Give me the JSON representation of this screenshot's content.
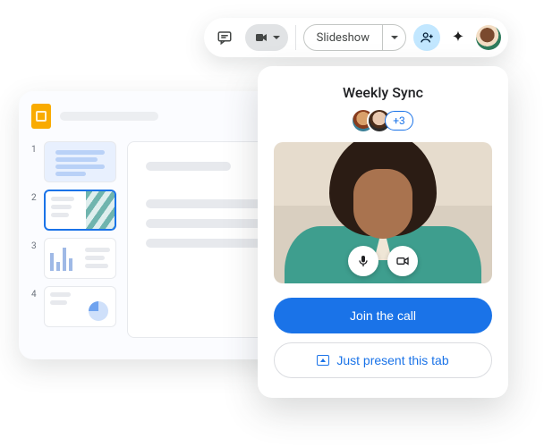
{
  "colors": {
    "accent": "#1a73e8"
  },
  "toolbar": {
    "slideshow_label": "Slideshow"
  },
  "editor": {
    "thumb_numbers": [
      "1",
      "2",
      "3",
      "4"
    ],
    "selected_index": 1
  },
  "meet": {
    "title": "Weekly Sync",
    "extra_participants": "+3",
    "join_label": "Join the call",
    "present_label": "Just present this tab"
  }
}
